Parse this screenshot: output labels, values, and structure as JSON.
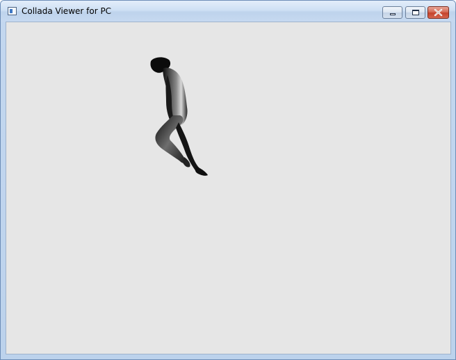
{
  "window": {
    "title": "Collada Viewer for PC",
    "controls": {
      "minimize_icon": "minimize-icon",
      "maximize_icon": "maximize-icon",
      "close_icon": "close-icon"
    }
  },
  "viewport": {
    "background": "#e6e6e6",
    "model": "human-figure-model"
  },
  "colors": {
    "close_button": "#c4412a",
    "titlebar": "#cfe0f4"
  }
}
